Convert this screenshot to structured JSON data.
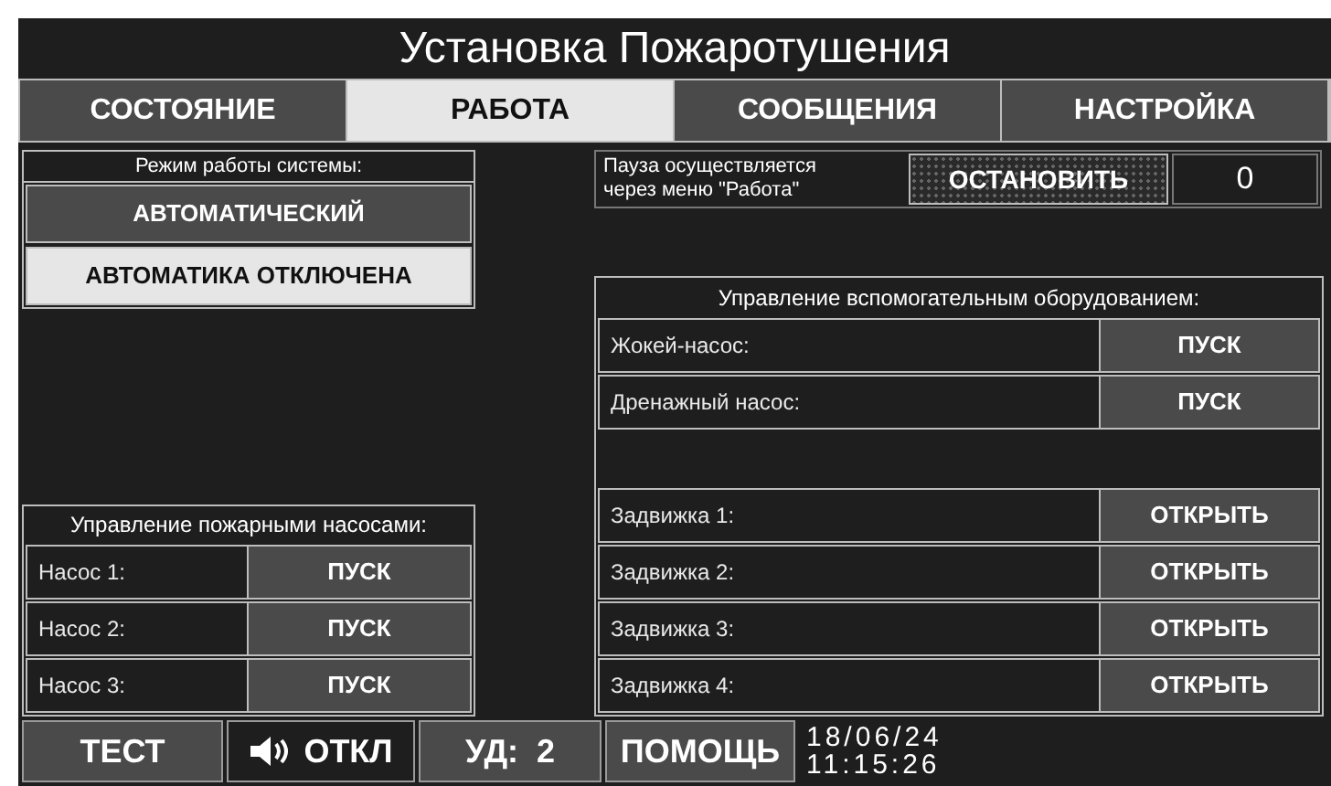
{
  "window": {
    "title": "Установка Пожаротушения"
  },
  "tabs": [
    {
      "label": "СОСТОЯНИЕ",
      "selected": false
    },
    {
      "label": "РАБОТА",
      "selected": true
    },
    {
      "label": "СООБЩЕНИЯ",
      "selected": false
    },
    {
      "label": "НАСТРОЙКА",
      "selected": false
    }
  ],
  "system_mode": {
    "title": "Режим работы системы:",
    "options": [
      {
        "label": "АВТОМАТИЧЕСКИЙ",
        "selected": false
      },
      {
        "label": "АВТОМАТИКА ОТКЛЮЧЕНА",
        "selected": true
      }
    ]
  },
  "pause": {
    "note": "Пауза осуществляется через меню \"Работа\"",
    "button": "ОСТАНОВИТЬ",
    "counter": "0"
  },
  "fire_pumps": {
    "title": "Управление пожарными насосами:",
    "rows": [
      {
        "name": "Насос 1:",
        "action": "ПУСК"
      },
      {
        "name": "Насос 2:",
        "action": "ПУСК"
      },
      {
        "name": "Насос 3:",
        "action": "ПУСК"
      }
    ]
  },
  "auxiliary": {
    "title": "Управление вспомогательным оборудованием:",
    "pumps": [
      {
        "name": "Жокей-насос:",
        "action": "ПУСК"
      },
      {
        "name": "Дренажный насос:",
        "action": "ПУСК"
      }
    ],
    "valves": [
      {
        "name": "Задвижка 1:",
        "action": "ОТКРЫТЬ"
      },
      {
        "name": "Задвижка 2:",
        "action": "ОТКРЫТЬ"
      },
      {
        "name": "Задвижка 3:",
        "action": "ОТКРЫТЬ"
      },
      {
        "name": "Задвижка 4:",
        "action": "ОТКРЫТЬ"
      }
    ]
  },
  "bottom_bar": {
    "buttons": [
      {
        "kind": "plain",
        "label": "ТЕСТ"
      },
      {
        "kind": "sound",
        "label": "ОТКЛ"
      },
      {
        "kind": "plain",
        "label": "УД:  2"
      },
      {
        "kind": "plain",
        "label": "ПОМОЩЬ"
      }
    ],
    "date": "18/06/24",
    "time": "11:15:26"
  }
}
